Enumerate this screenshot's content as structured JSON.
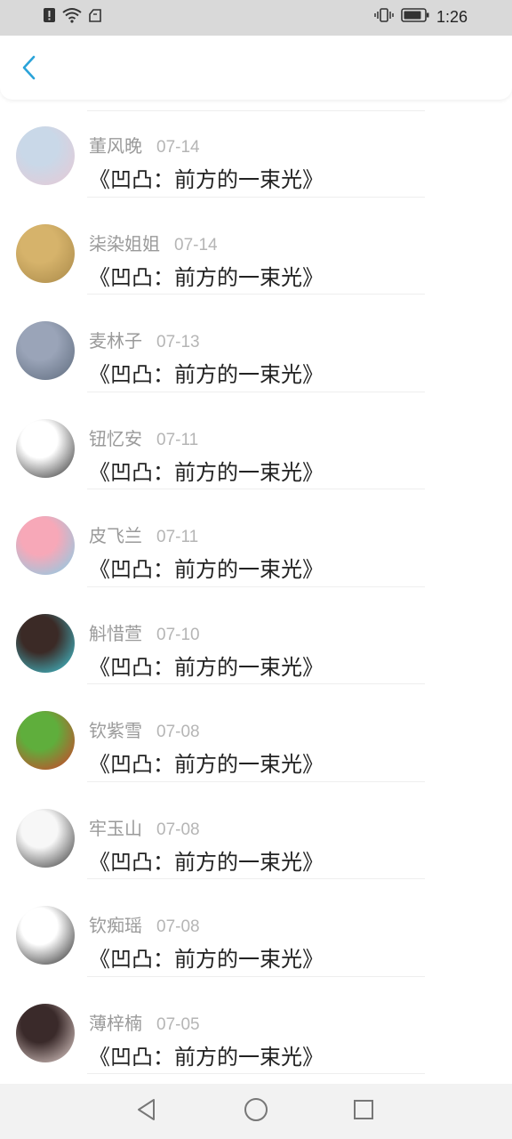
{
  "status_bar": {
    "time": "1:26",
    "icons": [
      "alert-icon",
      "wifi-icon",
      "notification-icon",
      "vibrate-icon",
      "battery-icon"
    ]
  },
  "header": {
    "back_icon": "back-chevron-icon",
    "accent": "#2aa3d9"
  },
  "list": [
    {
      "name": "董风晚",
      "date": "07-14",
      "title": "《凹凸：前方的一束光》",
      "avatar_colors": [
        "#c9d8e8",
        "#e8c8d4"
      ]
    },
    {
      "name": "柒染姐姐",
      "date": "07-14",
      "title": "《凹凸：前方的一束光》",
      "avatar_colors": [
        "#d6b36b",
        "#a88848"
      ]
    },
    {
      "name": "麦林子",
      "date": "07-13",
      "title": "《凹凸：前方的一束光》",
      "avatar_colors": [
        "#9aa4b8",
        "#5d6a7c"
      ]
    },
    {
      "name": "钮忆安",
      "date": "07-11",
      "title": "《凹凸：前方的一束光》",
      "avatar_colors": [
        "#ffffff",
        "#2a2a2a"
      ]
    },
    {
      "name": "皮飞兰",
      "date": "07-11",
      "title": "《凹凸：前方的一束光》",
      "avatar_colors": [
        "#f7a8b8",
        "#7fd0ea"
      ]
    },
    {
      "name": "斛惜萱",
      "date": "07-10",
      "title": "《凹凸：前方的一束光》",
      "avatar_colors": [
        "#3b2a26",
        "#42d0e0"
      ]
    },
    {
      "name": "钦紫雪",
      "date": "07-08",
      "title": "《凹凸：前方的一束光》",
      "avatar_colors": [
        "#5fae3c",
        "#d83a2a"
      ]
    },
    {
      "name": "牢玉山",
      "date": "07-08",
      "title": "《凹凸：前方的一束光》",
      "avatar_colors": [
        "#f7f7f7",
        "#333333"
      ]
    },
    {
      "name": "钦痴瑶",
      "date": "07-08",
      "title": "《凹凸：前方的一束光》",
      "avatar_colors": [
        "#ffffff",
        "#222222"
      ]
    },
    {
      "name": "薄梓楠",
      "date": "07-05",
      "title": "《凹凸：前方的一束光》",
      "avatar_colors": [
        "#3a2a2a",
        "#e8d6d2"
      ]
    }
  ],
  "nav_bar": {
    "back": "nav-back-icon",
    "home": "nav-home-icon",
    "recents": "nav-recents-icon"
  }
}
